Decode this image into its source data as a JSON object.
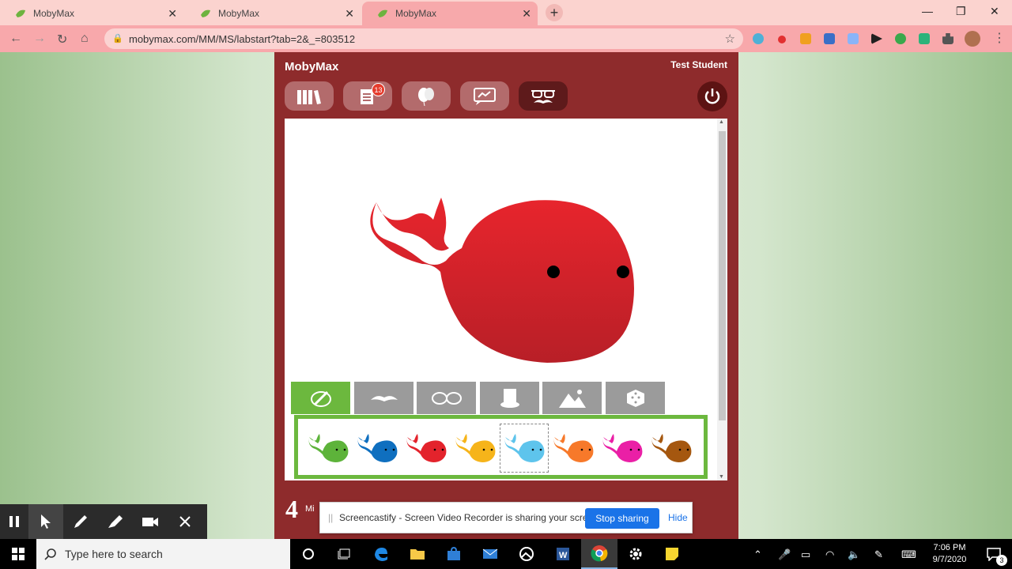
{
  "browser": {
    "tabs": [
      {
        "title": "MobyMax",
        "close": "✕"
      },
      {
        "title": "MobyMax",
        "close": "✕"
      },
      {
        "title": "MobyMax",
        "close": "✕"
      }
    ],
    "new_tab": "+",
    "window_controls": {
      "minimize": "—",
      "restore": "❐",
      "close": "✕"
    },
    "url": "mobymax.com/MM/MS/labstart?tab=2&_=803512"
  },
  "app": {
    "brand": "MobyMax",
    "student_name": "Test Student",
    "nav_badge_count": "13",
    "nav_buttons": [
      "library-icon",
      "assignments-icon",
      "balloons-icon",
      "messages-icon",
      "avatar-disguise-icon"
    ],
    "category_tabs": [
      "paint-icon",
      "mustache-icon",
      "glasses-icon",
      "hat-icon",
      "background-icon",
      "random-icon"
    ],
    "color_swatches": [
      {
        "color": "#5db33a",
        "selected": false
      },
      {
        "color": "#0f6fbf",
        "selected": false
      },
      {
        "color": "#e3232c",
        "selected": false
      },
      {
        "color": "#f6b41a",
        "selected": false
      },
      {
        "color": "#5ec4ec",
        "selected": true
      },
      {
        "color": "#f7792a",
        "selected": false
      },
      {
        "color": "#ea1fa6",
        "selected": false
      },
      {
        "color": "#a5570f",
        "selected": false
      }
    ],
    "whale_color": "#e3232c",
    "minutes_value": "4",
    "minutes_label": "Mi"
  },
  "screencastify": {
    "message": "Screencastify - Screen Video Recorder is sharing your screen.",
    "stop_label": "Stop sharing",
    "hide_label": "Hide"
  },
  "taskbar": {
    "search_placeholder": "Type here to search",
    "time": "7:06 PM",
    "date": "9/7/2020",
    "notification_count": "3"
  }
}
